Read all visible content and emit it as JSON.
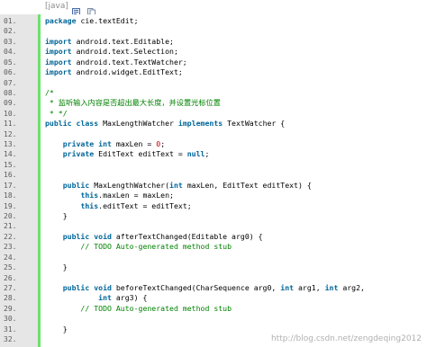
{
  "toolbar": {
    "language_label": "[java]",
    "icons": [
      "view-source-icon",
      "copy-icon"
    ]
  },
  "code": {
    "lines": [
      {
        "num": "01.",
        "text": "package cie.textEdit;"
      },
      {
        "num": "02.",
        "text": ""
      },
      {
        "num": "03.",
        "text": "import android.text.Editable;"
      },
      {
        "num": "04.",
        "text": "import android.text.Selection;"
      },
      {
        "num": "05.",
        "text": "import android.text.TextWatcher;"
      },
      {
        "num": "06.",
        "text": "import android.widget.EditText;"
      },
      {
        "num": "07.",
        "text": ""
      },
      {
        "num": "08.",
        "text": "/*"
      },
      {
        "num": "09.",
        "text": " * 监听输入内容是否超出最大长度，并设置光标位置"
      },
      {
        "num": "10.",
        "text": " * */"
      },
      {
        "num": "11.",
        "text": "public class MaxLengthWatcher implements TextWatcher {"
      },
      {
        "num": "12.",
        "text": ""
      },
      {
        "num": "13.",
        "text": "    private int maxLen = 0;"
      },
      {
        "num": "14.",
        "text": "    private EditText editText = null;"
      },
      {
        "num": "15.",
        "text": ""
      },
      {
        "num": "16.",
        "text": ""
      },
      {
        "num": "17.",
        "text": "    public MaxLengthWatcher(int maxLen, EditText editText) {"
      },
      {
        "num": "18.",
        "text": "        this.maxLen = maxLen;"
      },
      {
        "num": "19.",
        "text": "        this.editText = editText;"
      },
      {
        "num": "20.",
        "text": "    }"
      },
      {
        "num": "21.",
        "text": ""
      },
      {
        "num": "22.",
        "text": "    public void afterTextChanged(Editable arg0) {"
      },
      {
        "num": "23.",
        "text": "        // TODO Auto-generated method stub"
      },
      {
        "num": "24.",
        "text": ""
      },
      {
        "num": "25.",
        "text": "    }"
      },
      {
        "num": "26.",
        "text": ""
      },
      {
        "num": "27.",
        "text": "    public void beforeTextChanged(CharSequence arg0, int arg1, int arg2,"
      },
      {
        "num": "28.",
        "text": "            int arg3) {"
      },
      {
        "num": "29.",
        "text": "        // TODO Auto-generated method stub"
      },
      {
        "num": "30.",
        "text": ""
      },
      {
        "num": "31.",
        "text": "    }"
      },
      {
        "num": "32.",
        "text": ""
      }
    ]
  },
  "watermark": "http://blog.csdn.net/zengdeqing2012",
  "colors": {
    "gutter_bg": "#e6e6e6",
    "gutter_border": "#6ce26c",
    "keyword": "#006699",
    "comment": "#008200",
    "number": "#c00000",
    "line_number": "#5c5c5c"
  }
}
